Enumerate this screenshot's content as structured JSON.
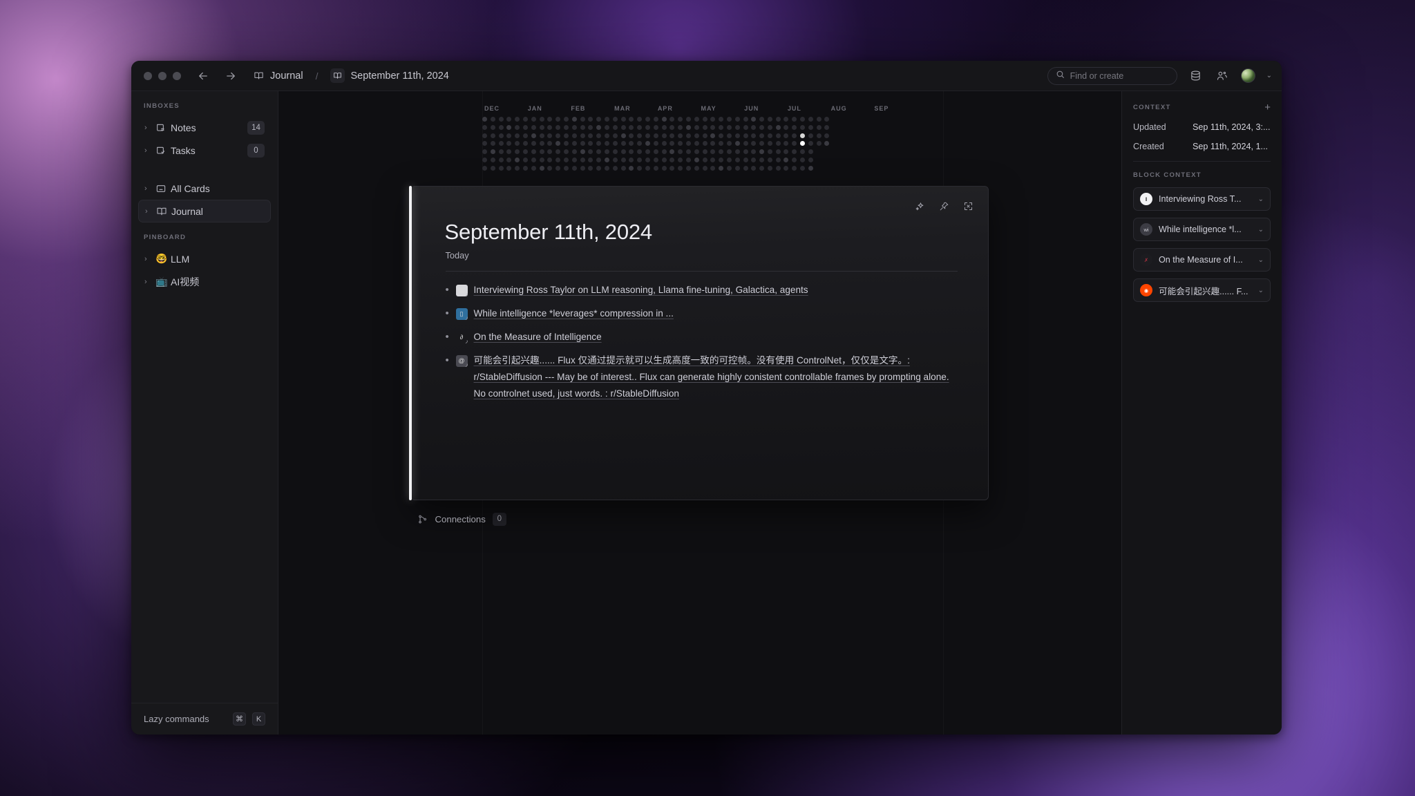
{
  "titlebar": {
    "back_icon": "arrow-left-icon",
    "forward_icon": "arrow-right-icon",
    "breadcrumb": [
      {
        "icon": "book-icon",
        "label": "Journal"
      },
      {
        "icon": "book-icon",
        "label": "September 11th, 2024"
      }
    ],
    "separator": "/",
    "search_placeholder": "Find or create",
    "search_value": "",
    "icons": [
      "database-icon",
      "people-icon"
    ],
    "avatar_chevron": "⌄"
  },
  "sidebar": {
    "sections": [
      {
        "label": "INBOXES",
        "items": [
          {
            "label": "Notes",
            "icon": "inbox-notes-icon",
            "badge": "14"
          },
          {
            "label": "Tasks",
            "icon": "inbox-tasks-icon",
            "badge": "0"
          }
        ]
      },
      {
        "label": "",
        "items": [
          {
            "label": "All Cards",
            "icon": "cards-icon",
            "badge": ""
          },
          {
            "label": "Journal",
            "icon": "book-icon",
            "badge": "",
            "active": true
          }
        ]
      },
      {
        "label": "PINBOARD",
        "items": [
          {
            "label": "LLM",
            "emoji": "🤓",
            "badge": ""
          },
          {
            "label": "AI视频",
            "emoji": "📺",
            "badge": ""
          }
        ]
      }
    ],
    "footer": {
      "label": "Lazy commands",
      "keys": [
        "⌘",
        "K"
      ]
    }
  },
  "heatmap": {
    "months": [
      "DEC",
      "JAN",
      "FEB",
      "MAR",
      "APR",
      "MAY",
      "JUN",
      "JUL",
      "AUG",
      "SEP"
    ],
    "columns": 43,
    "rows": 7,
    "highlighted": [
      {
        "col": 39,
        "row": 2,
        "level": "warm"
      },
      {
        "col": 39,
        "row": 3,
        "level": "hot"
      }
    ]
  },
  "card": {
    "title": "September 11th, 2024",
    "subtitle": "Today",
    "tools": [
      "sparkle-icon",
      "pin-icon",
      "expand-icon"
    ],
    "bullets": [
      {
        "icon": "website-favicon",
        "icon_color": "#d8d8dc",
        "icon_glyph": "▤",
        "text": "Interviewing Ross Taylor on LLM reasoning, Llama fine-tuning, Galactica, agents"
      },
      {
        "icon": "website-favicon",
        "icon_color": "#2f6f9e",
        "icon_glyph": "▯",
        "text": "While intelligence *leverages* compression in ..."
      },
      {
        "icon": "link-icon",
        "icon_color": "transparent",
        "icon_glyph": "∂",
        "text": "On the Measure of Intelligence"
      },
      {
        "icon": "website-favicon",
        "icon_color": "#4a4a52",
        "icon_glyph": "@",
        "text": "可能会引起兴趣...... Flux 仅通过提示就可以生成高度一致的可控帧。没有使用 ControlNet，仅仅是文字。: r/StableDiffusion --- May be of interest.. Flux can generate highly conistent controllable frames by prompting alone. No controlnet used, just words. : r/StableDiffusion"
      }
    ]
  },
  "connections": {
    "icon": "git-branch-icon",
    "label": "Connections",
    "count": "0"
  },
  "rightpanel": {
    "context_title": "CONTEXT",
    "add_icon": "plus-icon",
    "rows": [
      {
        "key": "Updated",
        "value": "Sep 11th, 2024, 3:..."
      },
      {
        "key": "Created",
        "value": "Sep 11th, 2024, 1..."
      }
    ],
    "block_context_title": "BLOCK CONTEXT",
    "block_items": [
      {
        "label": "Interviewing Ross T...",
        "avatar": "white-circle-logo",
        "avatar_bg": "#f2f2f4",
        "avatar_fg": "#1a1a1a",
        "avatar_text": "ǁ",
        "chevron": "⌄"
      },
      {
        "label": "While intelligence *l...",
        "avatar": "gray-wi-logo",
        "avatar_bg": "#3c3c44",
        "avatar_fg": "#cfcfd6",
        "avatar_text": "wi",
        "chevron": "⌄"
      },
      {
        "label": "On the Measure of I...",
        "avatar": "arxiv-logo",
        "avatar_bg": "#1c1c20",
        "avatar_fg": "#b03040",
        "avatar_text": "✗",
        "chevron": "⌄"
      },
      {
        "label": "可能会引起兴趣...... F...",
        "avatar": "reddit-logo",
        "avatar_bg": "#ff4500",
        "avatar_fg": "#ffffff",
        "avatar_text": "◉",
        "chevron": "⌄"
      }
    ]
  },
  "colors": {
    "accent_white": "#f2f2f4",
    "window_bg": "#111114",
    "sidebar_bg": "#18181b"
  }
}
